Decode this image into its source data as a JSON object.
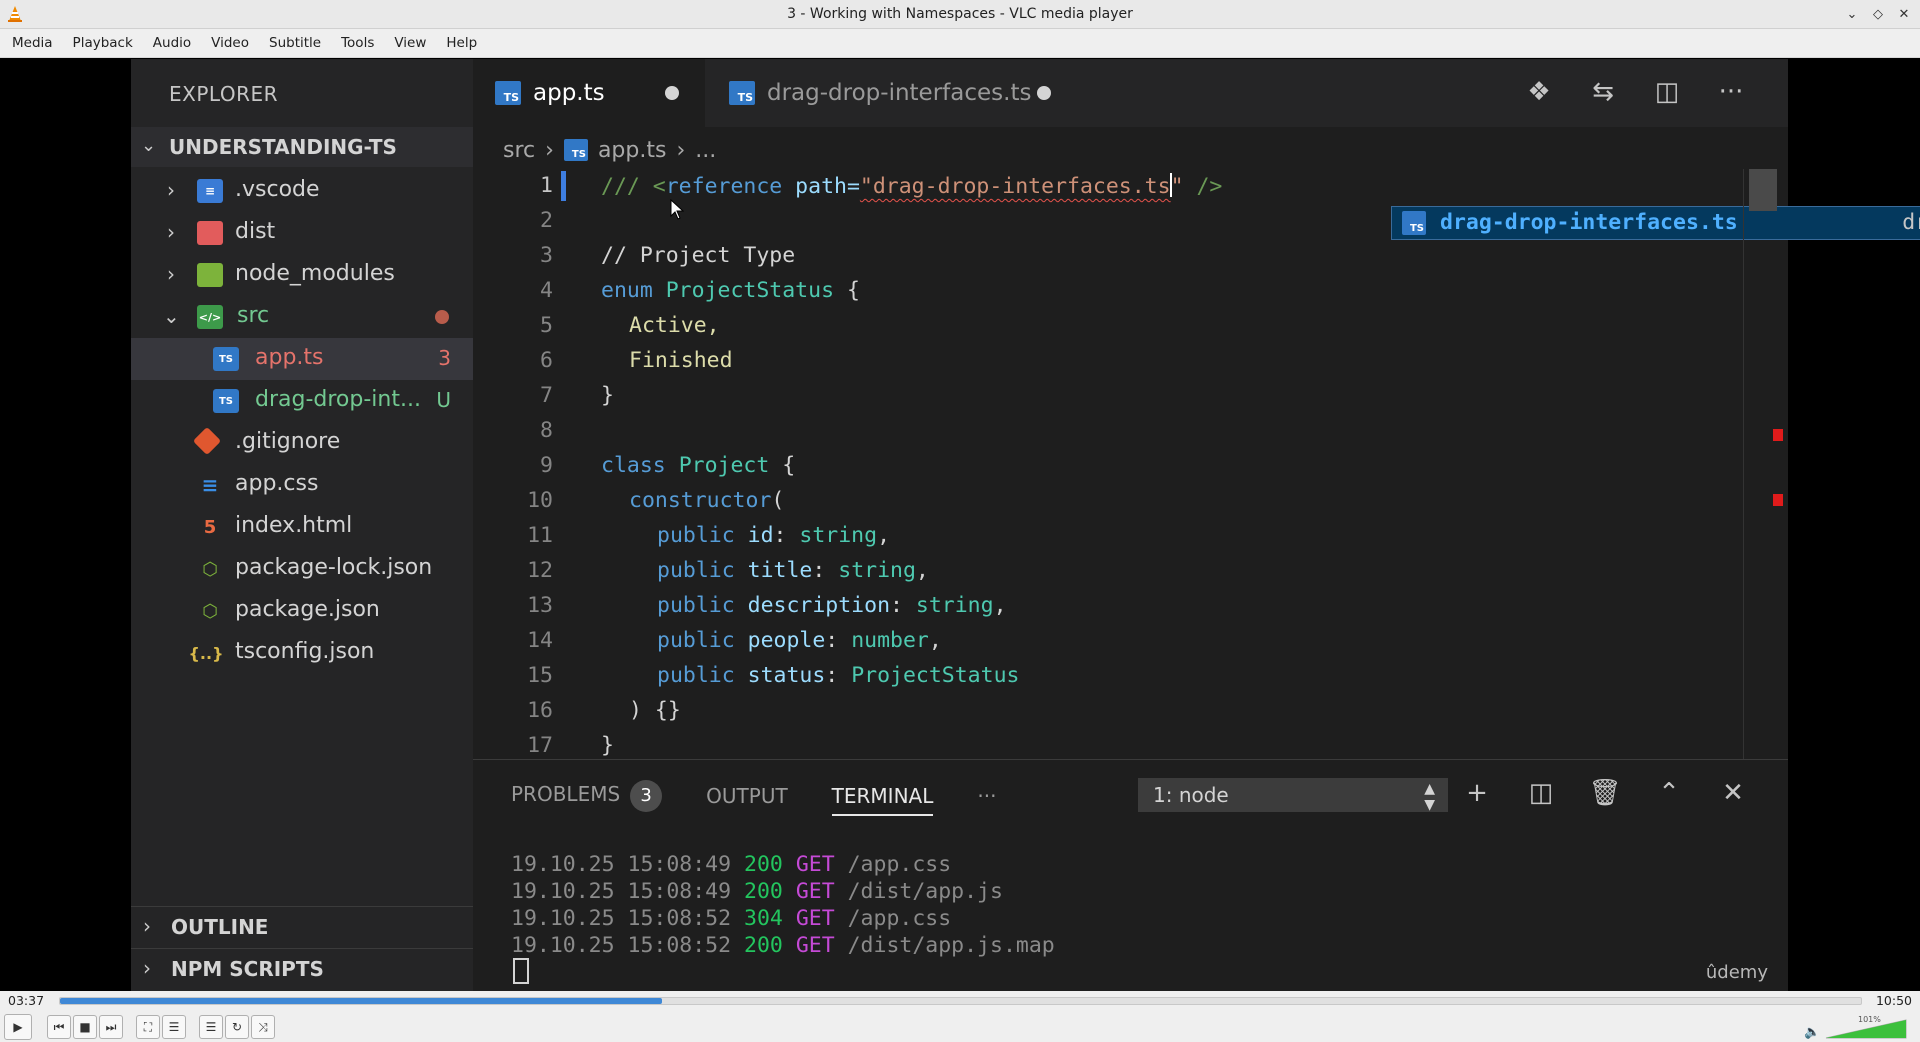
{
  "window": {
    "title": "3 - Working with Namespaces - VLC media player"
  },
  "menu": [
    "Media",
    "Playback",
    "Audio",
    "Video",
    "Subtitle",
    "Tools",
    "View",
    "Help"
  ],
  "vscode": {
    "explorer_title": "EXPLORER",
    "project_name": "UNDERSTANDING-TS",
    "tree": [
      {
        "name": ".vscode",
        "icon": "vscode-folder-icon",
        "expandable": true,
        "expanded": false
      },
      {
        "name": "dist",
        "icon": "dist-folder-icon",
        "expandable": true,
        "expanded": false
      },
      {
        "name": "node_modules",
        "icon": "node-folder-icon",
        "expandable": true,
        "expanded": false
      },
      {
        "name": "src",
        "icon": "src-folder-icon",
        "expandable": true,
        "expanded": true
      },
      {
        "name": "app.ts",
        "icon": "ts-file-icon",
        "badge": "3"
      },
      {
        "name": "drag-drop-int...",
        "icon": "ts-file-icon",
        "badge": "U"
      },
      {
        "name": ".gitignore",
        "icon": "git-file-icon"
      },
      {
        "name": "app.css",
        "icon": "css-file-icon"
      },
      {
        "name": "index.html",
        "icon": "html-file-icon"
      },
      {
        "name": "package-lock.json",
        "icon": "json-node-file-icon"
      },
      {
        "name": "package.json",
        "icon": "json-node-file-icon"
      },
      {
        "name": "tsconfig.json",
        "icon": "json-braces-file-icon"
      }
    ],
    "outline_label": "OUTLINE",
    "npm_scripts_label": "NPM SCRIPTS",
    "tabs": [
      {
        "label": "app.ts",
        "badge": "TS",
        "modified": true,
        "active": true
      },
      {
        "label": "drag-drop-interfaces.ts",
        "badge": "TS",
        "modified": true,
        "active": false
      }
    ],
    "breadcrumb": {
      "folder": "src",
      "file": "app.ts",
      "more": "...",
      "badge": "TS"
    },
    "line_numbers": [
      "1",
      "2",
      "3",
      "4",
      "5",
      "6",
      "7",
      "8",
      "9",
      "10",
      "11",
      "12",
      "13",
      "14",
      "15",
      "16",
      "17"
    ],
    "code": {
      "l1_a": "/// <",
      "l1_b": "reference",
      "l1_c": " path=",
      "l1_d": "\"drag-drop-interfaces.ts",
      "l1_e": "\"",
      "l1_f": " />",
      "l3": "// Project Type",
      "l4_kw": "enum",
      "l4_name": "ProjectStatus",
      "l4_brace": " {",
      "l5": "Active,",
      "l6": "Finished",
      "l7": "}",
      "l9_kw": "class",
      "l9_name": "Project",
      "l9_brace": " {",
      "l10_kw": "constructor",
      "l10_paren": "(",
      "l11_kw": "public",
      "l11_prop": "id",
      "l11_type": "string",
      "l12_kw": "public",
      "l12_prop": "title",
      "l12_type": "string",
      "l13_kw": "public",
      "l13_prop": "description",
      "l13_type": "string",
      "l14_kw": "public",
      "l14_prop": "people",
      "l14_type": "number",
      "l15_kw": "public",
      "l15_prop": "status",
      "l15_type": "ProjectStatus",
      "l16": ") {}",
      "l17": "}"
    },
    "suggestion": {
      "label": "drag-drop-interfaces.ts",
      "detail": "drag-drop-interfaces.ts",
      "badge": "TS"
    },
    "panel": {
      "problems_label": "PROBLEMS",
      "problems_count": "3",
      "output_label": "OUTPUT",
      "terminal_label": "TERMINAL",
      "more": "···",
      "terminal_select": "1: node",
      "log": [
        {
          "date": "19.10.25 15:08:49",
          "status": "200",
          "method": "GET",
          "path": "/app.css"
        },
        {
          "date": "19.10.25 15:08:49",
          "status": "200",
          "method": "GET",
          "path": "/dist/app.js"
        },
        {
          "date": "19.10.25 15:08:52",
          "status": "304",
          "method": "GET",
          "path": "/app.css"
        },
        {
          "date": "19.10.25 15:08:52",
          "status": "200",
          "method": "GET",
          "path": "/dist/app.js.map"
        }
      ]
    },
    "watermark": "ûdemy"
  },
  "player": {
    "elapsed": "03:37",
    "total": "10:50",
    "progress": 0.334,
    "volume_label": "101%",
    "volume": 1.01
  },
  "colors": {
    "accent": "#3f88d6",
    "error": "#e5534b",
    "ts_badge": "#3178c6"
  }
}
